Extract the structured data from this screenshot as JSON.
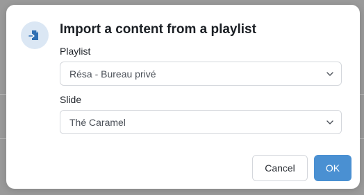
{
  "dialog": {
    "icon": "import-file-icon",
    "title": "Import a content from a playlist",
    "playlist": {
      "label": "Playlist",
      "selected": "Résa - Bureau privé"
    },
    "slide": {
      "label": "Slide",
      "selected": "Thé Caramel"
    },
    "cancel_label": "Cancel",
    "ok_label": "OK"
  },
  "colors": {
    "accent": "#4a90d2",
    "icon_bg": "#dbe7f4",
    "overlay": "#9a9a9a"
  }
}
